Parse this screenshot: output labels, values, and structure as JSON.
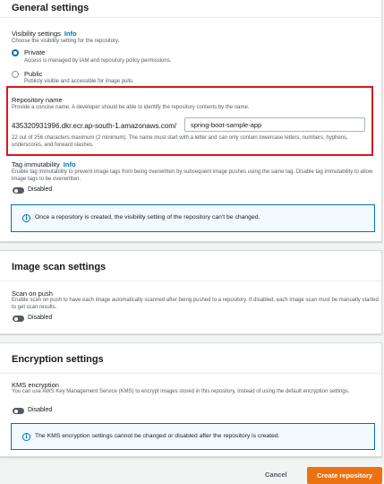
{
  "general": {
    "title": "General settings",
    "visibility": {
      "label": "Visibility settings",
      "info": "Info",
      "desc": "Choose the visibility setting for the repository.",
      "options": [
        {
          "label": "Private",
          "desc": "Access is managed by IAM and repository policy permissions.",
          "selected": true
        },
        {
          "label": "Public",
          "desc": "Publicly visible and accessible for image pulls.",
          "selected": false
        }
      ]
    },
    "repo": {
      "label": "Repository name",
      "desc": "Provide a concise name. A developer should be able to identify the repository contents by the name.",
      "uri_prefix": "435320931996.dkr.ecr.ap-south-1.amazonaws.com/",
      "value": "spring-boot-sample-app",
      "hint": "22 out of 256 characters maximum (2 minimum). The name must start with a letter and can only contain lowercase letters, numbers, hyphens, underscores, and forward slashes."
    },
    "tag": {
      "label": "Tag immutability",
      "info": "Info",
      "desc": "Enable tag immutability to prevent image tags from being overwritten by subsequent image pushes using the same tag. Disable tag immutability to allow image tags to be overwritten.",
      "state": "Disabled"
    },
    "alert": "Once a repository is created, the visibility setting of the repository can't be changed."
  },
  "scan": {
    "title": "Image scan settings",
    "label": "Scan on push",
    "desc": "Enable scan on push to have each image automatically scanned after being pushed to a repository. If disabled, each image scan must be manually started to get scan results.",
    "state": "Disabled"
  },
  "encryption": {
    "title": "Encryption settings",
    "label": "KMS encryption",
    "desc": "You can use AWS Key Management Service (KMS) to encrypt images stored in this repository, instead of using the default encryption settings.",
    "state": "Disabled",
    "alert": "The KMS encryption settings cannot be changed or disabled after the repository is created."
  },
  "footer": {
    "cancel": "Cancel",
    "create": "Create repository"
  },
  "colors": {
    "accent": "#0073bb",
    "primary_button": "#ec7211",
    "highlight_box": "#d9161f"
  }
}
